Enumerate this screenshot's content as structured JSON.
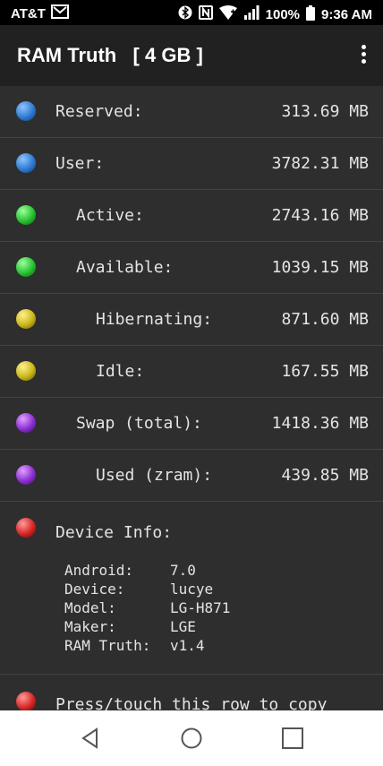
{
  "status_bar": {
    "carrier": "AT&T",
    "battery": "100%",
    "time": "9:36 AM"
  },
  "app_bar": {
    "title": "RAM Truth   [ 4 GB ]"
  },
  "memory_rows": [
    {
      "label": "Reserved:",
      "value": "313.69 MB",
      "color": "#2f7ad0"
    },
    {
      "label": "User:",
      "value": "3782.31 MB",
      "color": "#2f7ad0"
    },
    {
      "label": "Active:",
      "value": "2743.16 MB",
      "color": "#27c12f"
    },
    {
      "label": "Available:",
      "value": "1039.15 MB",
      "color": "#27c12f"
    },
    {
      "label": "Hibernating:",
      "value": "871.60 MB",
      "color": "#c9b51a"
    },
    {
      "label": "Idle:",
      "value": "167.55 MB",
      "color": "#c9b51a"
    },
    {
      "label": "Swap (total):",
      "value": "1418.36 MB",
      "color": "#8b2fd0"
    },
    {
      "label": "Used (zram):",
      "value": "439.85 MB",
      "color": "#8b2fd0"
    }
  ],
  "device_info": {
    "label": "Device Info:",
    "color": "#d62525",
    "rows": [
      {
        "key": "Android:",
        "value": "7.0"
      },
      {
        "key": "Device:",
        "value": "lucye"
      },
      {
        "key": "Model:",
        "value": "LG-H871"
      },
      {
        "key": "Maker:",
        "value": "LGE"
      },
      {
        "key": "RAM Truth:",
        "value": "v1.4"
      }
    ]
  },
  "copy_row": {
    "label": "Press/touch this row to copy",
    "color": "#d62525"
  }
}
